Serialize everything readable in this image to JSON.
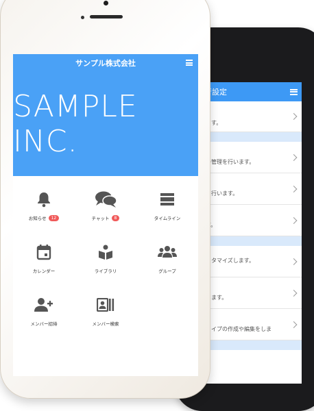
{
  "front": {
    "header_title": "サンプル株式会社",
    "hero_text": "SAMPLE INC.",
    "grid": [
      {
        "label": "お知らせ",
        "badge": "12",
        "icon": "bell-icon"
      },
      {
        "label": "チャット",
        "badge": "8",
        "icon": "chat-icon"
      },
      {
        "label": "タイムライン",
        "badge": "",
        "icon": "timeline-icon"
      },
      {
        "label": "カレンダー",
        "badge": "",
        "icon": "calendar-icon"
      },
      {
        "label": "ライブラリ",
        "badge": "",
        "icon": "library-icon"
      },
      {
        "label": "グループ",
        "badge": "",
        "icon": "group-icon"
      },
      {
        "label": "メンバー招待",
        "badge": "",
        "icon": "invite-member-icon"
      },
      {
        "label": "メンバー検索",
        "badge": "",
        "icon": "member-search-icon"
      }
    ]
  },
  "back": {
    "header_title": "者設定",
    "rows": [
      "ます。",
      "の管理を行います。",
      "を行います。",
      "す。",
      "スタマイズします。",
      "します。",
      "タイプの作成や編集をしま"
    ]
  },
  "colors": {
    "accent": "#4aa1f6",
    "badge": "#f05a5a",
    "section": "#d9e9fb"
  }
}
